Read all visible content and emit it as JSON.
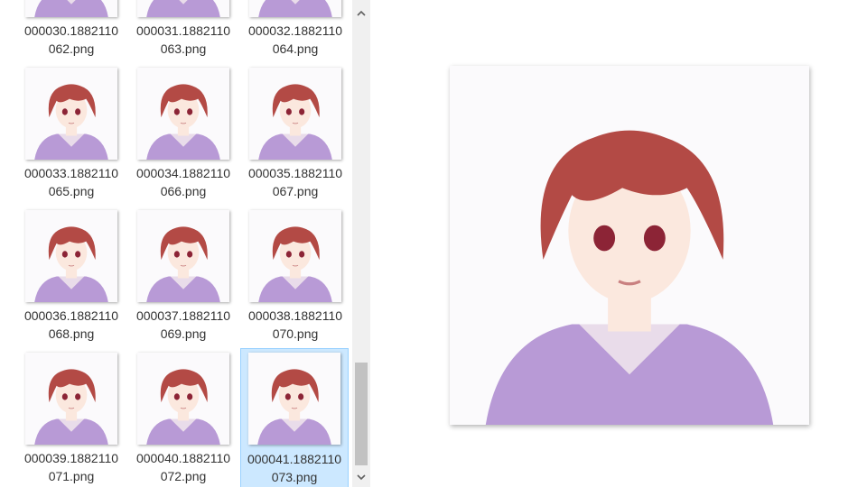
{
  "explorer": {
    "files": [
      {
        "name_line1": "000030.1882110",
        "name_line2": "062.png",
        "selected": false
      },
      {
        "name_line1": "000031.1882110",
        "name_line2": "063.png",
        "selected": false
      },
      {
        "name_line1": "000032.1882110",
        "name_line2": "064.png",
        "selected": false
      },
      {
        "name_line1": "000033.1882110",
        "name_line2": "065.png",
        "selected": false
      },
      {
        "name_line1": "000034.1882110",
        "name_line2": "066.png",
        "selected": false
      },
      {
        "name_line1": "000035.1882110",
        "name_line2": "067.png",
        "selected": false
      },
      {
        "name_line1": "000036.1882110",
        "name_line2": "068.png",
        "selected": false
      },
      {
        "name_line1": "000037.1882110",
        "name_line2": "069.png",
        "selected": false
      },
      {
        "name_line1": "000038.1882110",
        "name_line2": "070.png",
        "selected": false
      },
      {
        "name_line1": "000039.1882110",
        "name_line2": "071.png",
        "selected": false
      },
      {
        "name_line1": "000040.1882110",
        "name_line2": "072.png",
        "selected": false
      },
      {
        "name_line1": "000041.1882110",
        "name_line2": "073.png",
        "selected": true
      }
    ]
  },
  "scrollbar": {
    "up_icon": "chevron-up-icon",
    "down_icon": "chevron-down-icon",
    "position_fraction": 0.93
  },
  "preview": {
    "icon": "anime-portrait-image"
  },
  "colors": {
    "selection_bg": "#cce8ff",
    "selection_border": "#99d1ff",
    "hair": "#b34a45",
    "hoodie": "#b89ad6",
    "skin": "#fbe8de"
  }
}
